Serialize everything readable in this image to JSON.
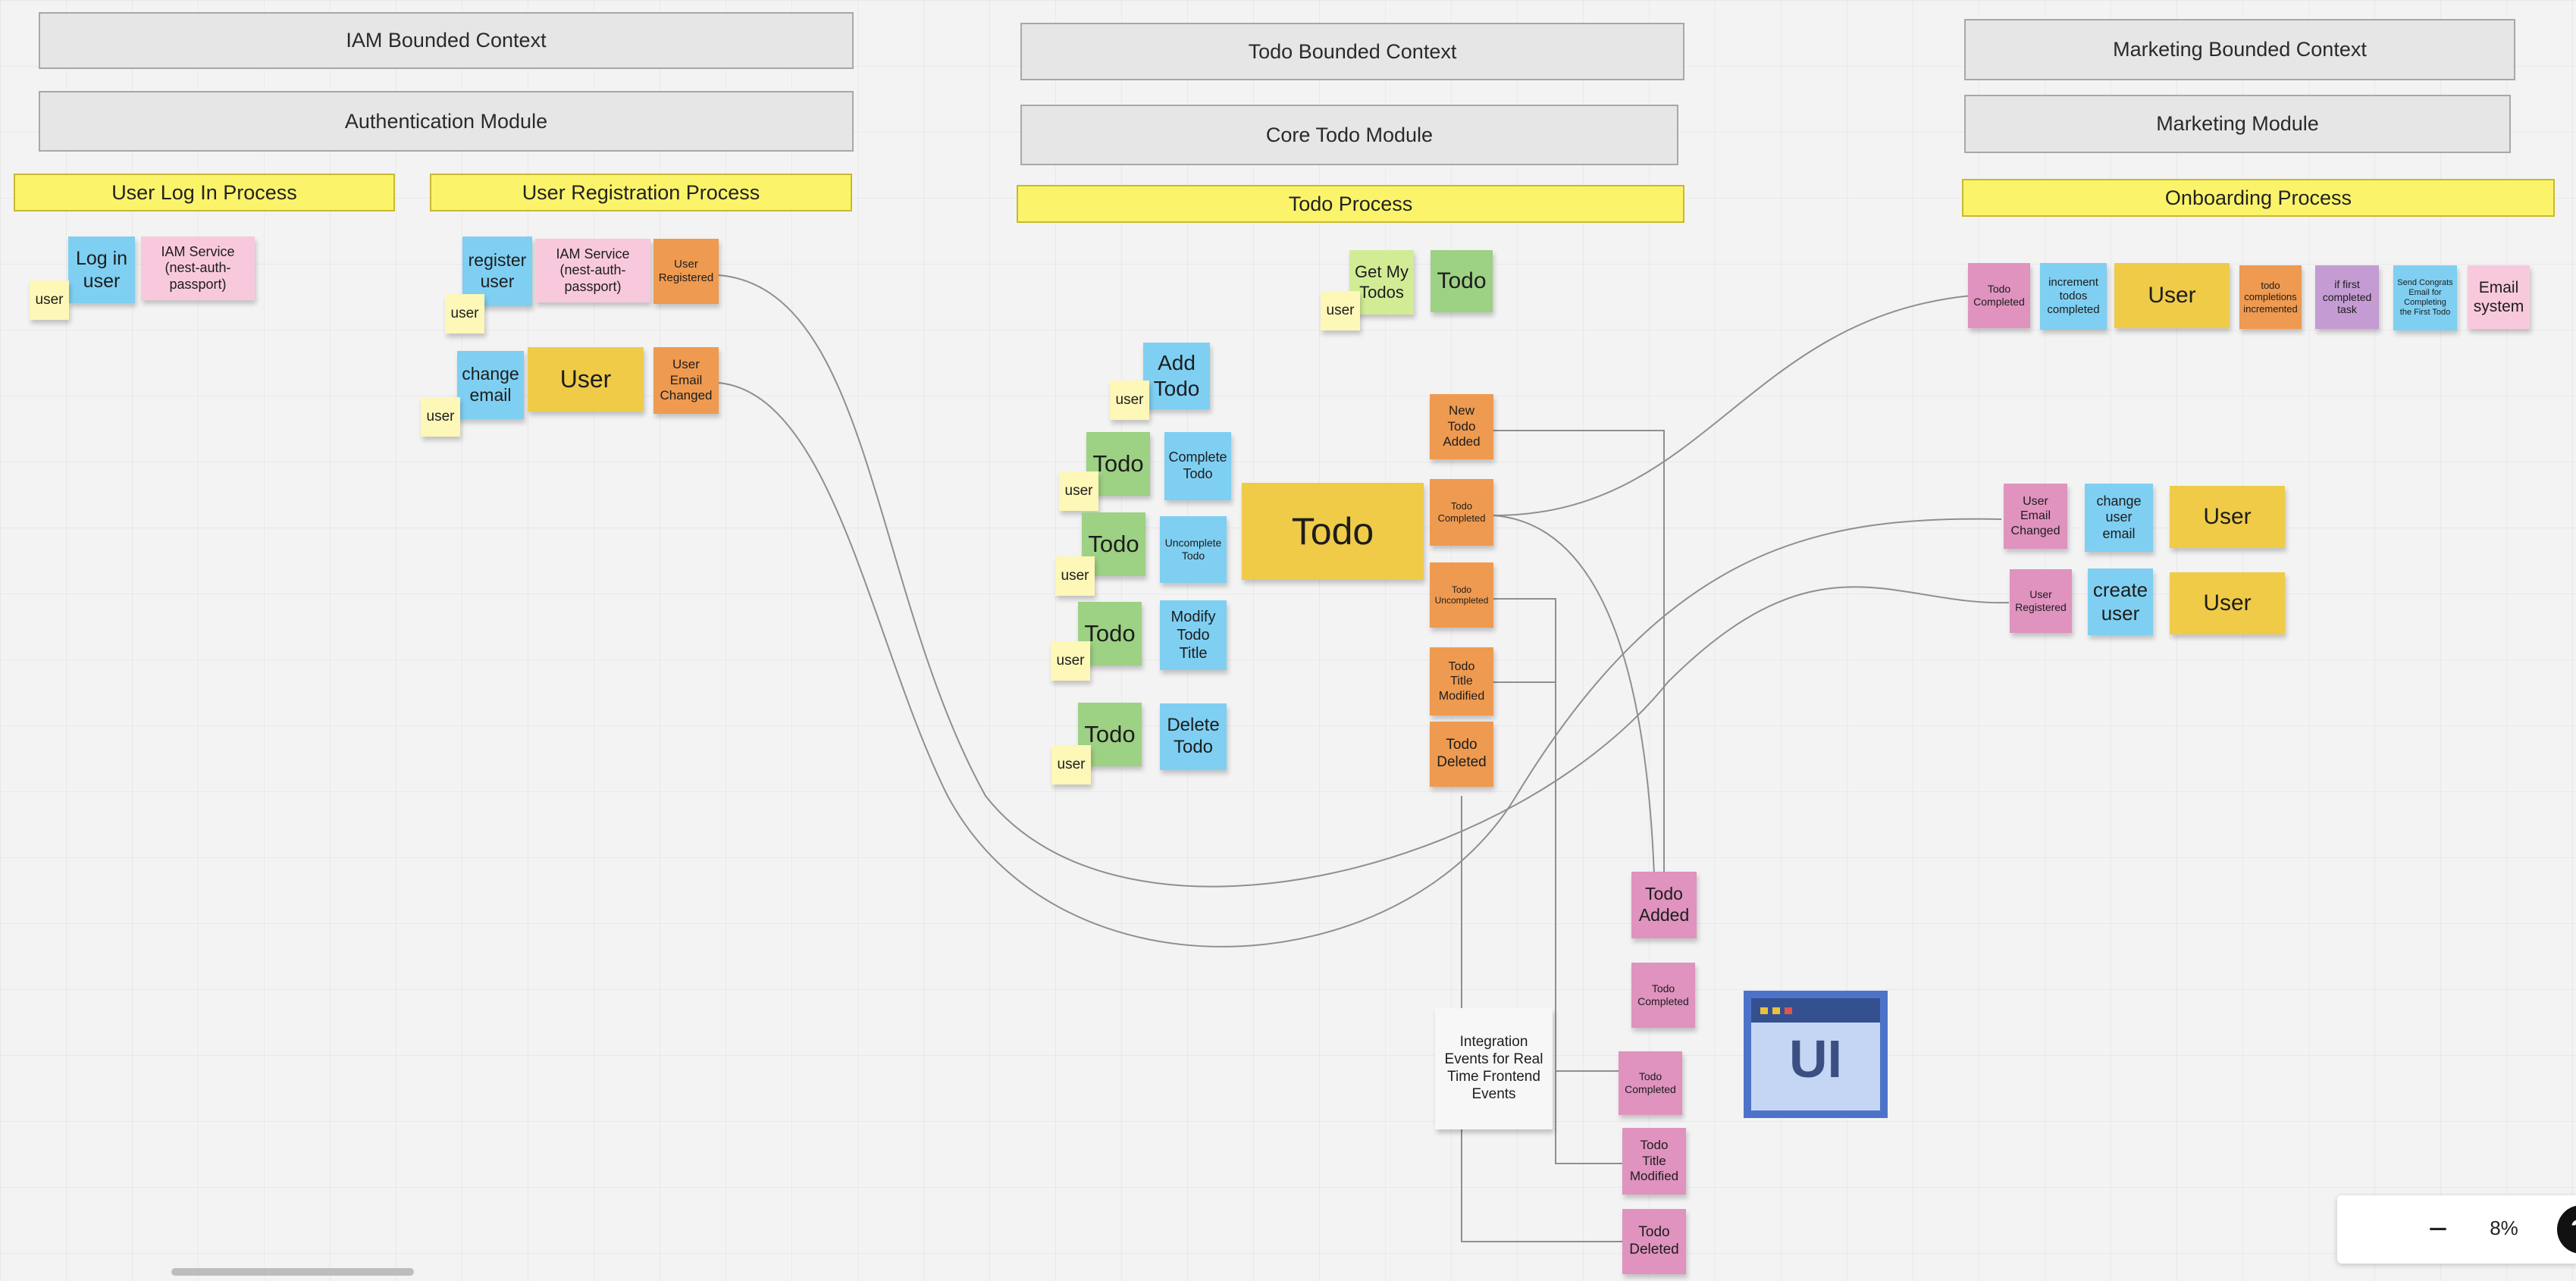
{
  "frames": [
    {
      "id": "iam-bounded-context",
      "label": "IAM Bounded Context"
    },
    {
      "id": "authentication-module",
      "label": "Authentication Module"
    },
    {
      "id": "todo-bounded-context",
      "label": "Todo Bounded Context"
    },
    {
      "id": "core-todo-module",
      "label": "Core Todo Module"
    },
    {
      "id": "marketing-bounded-context",
      "label": "Marketing Bounded Context"
    },
    {
      "id": "marketing-module",
      "label": "Marketing Module"
    }
  ],
  "processes": [
    {
      "id": "user-log-in-process",
      "label": "User Log In Process"
    },
    {
      "id": "user-registration-process",
      "label": "User Registration Process"
    },
    {
      "id": "todo-process",
      "label": "Todo Process"
    },
    {
      "id": "onboarding-process",
      "label": "Onboarding Process"
    }
  ],
  "stickies": [
    {
      "id": "s1",
      "text": "Log in\nuser"
    },
    {
      "id": "s2",
      "text": "IAM Service\n(nest-auth-\npassport)"
    },
    {
      "id": "s3",
      "text": "user"
    },
    {
      "id": "s4",
      "text": "register\nuser"
    },
    {
      "id": "s5",
      "text": "IAM Service\n(nest-auth-\npassport)"
    },
    {
      "id": "s6",
      "text": "User\nRegistered"
    },
    {
      "id": "s7",
      "text": "user"
    },
    {
      "id": "s8",
      "text": "change\nemail"
    },
    {
      "id": "s9",
      "text": "User"
    },
    {
      "id": "s10",
      "text": "User\nEmail\nChanged"
    },
    {
      "id": "s11",
      "text": "user"
    },
    {
      "id": "s12",
      "text": "Get My\nTodos"
    },
    {
      "id": "s13",
      "text": "Todo"
    },
    {
      "id": "s14",
      "text": "user"
    },
    {
      "id": "s15",
      "text": "Add\nTodo"
    },
    {
      "id": "s16",
      "text": "user"
    },
    {
      "id": "s17",
      "text": "Todo"
    },
    {
      "id": "s18",
      "text": "Complete\nTodo"
    },
    {
      "id": "s19",
      "text": "user"
    },
    {
      "id": "s20",
      "text": "Todo"
    },
    {
      "id": "s21",
      "text": "Uncomplete\nTodo"
    },
    {
      "id": "s22",
      "text": "user"
    },
    {
      "id": "s23",
      "text": "Todo"
    },
    {
      "id": "s24",
      "text": "Modify\nTodo\nTitle"
    },
    {
      "id": "s25",
      "text": "user"
    },
    {
      "id": "s26",
      "text": "Todo"
    },
    {
      "id": "s27",
      "text": "Delete\nTodo"
    },
    {
      "id": "s28",
      "text": "user"
    },
    {
      "id": "s29",
      "text": "Todo"
    },
    {
      "id": "s30",
      "text": "New\nTodo\nAdded"
    },
    {
      "id": "s31",
      "text": "Todo\nCompleted"
    },
    {
      "id": "s32",
      "text": "Todo\nUncompleted"
    },
    {
      "id": "s33",
      "text": "Todo\nTitle\nModified"
    },
    {
      "id": "s34",
      "text": "Todo\nDeleted"
    },
    {
      "id": "s35",
      "text": "Todo\nAdded"
    },
    {
      "id": "s36",
      "text": "Todo\nCompleted"
    },
    {
      "id": "s37",
      "text": "Todo\nCompleted"
    },
    {
      "id": "s38",
      "text": "Todo\nTitle\nModified"
    },
    {
      "id": "s39",
      "text": "Todo\nDeleted"
    },
    {
      "id": "s40",
      "text": "Integration\nEvents for Real\nTime Frontend\nEvents"
    },
    {
      "id": "s41",
      "text": "Todo\nCompleted"
    },
    {
      "id": "s42",
      "text": "increment\ntodos\ncompleted"
    },
    {
      "id": "s43",
      "text": "User"
    },
    {
      "id": "s44",
      "text": "todo\ncompletions\nincremented"
    },
    {
      "id": "s45",
      "text": "if first\ncompleted\ntask"
    },
    {
      "id": "s46",
      "text": "Send Congrats\nEmail for\nCompleting\nthe First Todo"
    },
    {
      "id": "s47",
      "text": "Email\nsystem"
    },
    {
      "id": "s48",
      "text": "User\nEmail\nChanged"
    },
    {
      "id": "s49",
      "text": "change\nuser\nemail"
    },
    {
      "id": "s50",
      "text": "User"
    },
    {
      "id": "s51",
      "text": "User\nRegistered"
    },
    {
      "id": "s52",
      "text": "create\nuser"
    },
    {
      "id": "s53",
      "text": "User"
    }
  ],
  "ui_widget": {
    "label": "UI",
    "dot_colors": [
      "#e9c23c",
      "#e9c23c",
      "#e2554e"
    ]
  },
  "zoom": {
    "level": "8%",
    "minus": "−",
    "plus": "+"
  },
  "help": {
    "label": "?"
  },
  "colors": {
    "process_yellow": "#fbf46b",
    "frame_grey": "#e6e6e6",
    "event_orange": "#ee9a50",
    "command_blue": "#7fcff2",
    "aggregate_gold": "#efcb48",
    "integration_event_pink": "#df93be",
    "policy_purple": "#c49bd3",
    "external_system_pink": "#f8c9dc",
    "read_model_green": "#9dd184",
    "actor_yellow": "#fdf7b8"
  }
}
